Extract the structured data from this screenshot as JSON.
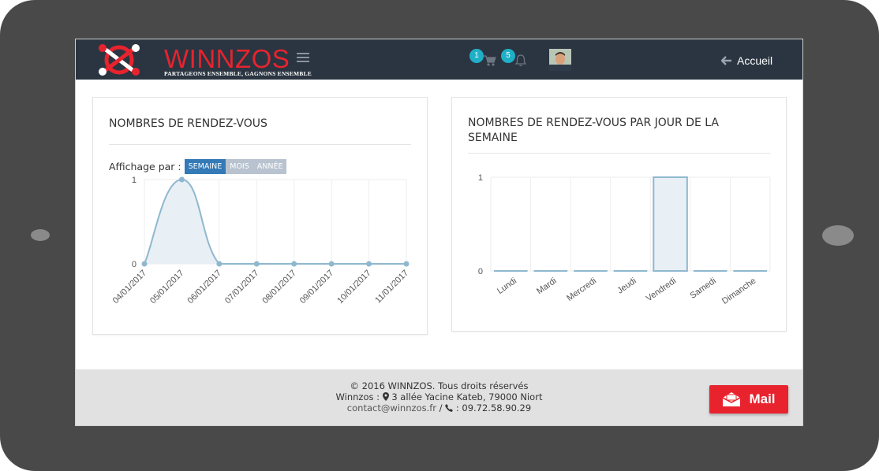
{
  "navbar": {
    "brand": "WINNZOS",
    "tagline": "PARTAGEONS ENSEMBLE, GAGNONS ENSEMBLE",
    "cart_count": "1",
    "notification_count": "5",
    "home_label": "Accueil"
  },
  "left_panel": {
    "title": "NOMBRES DE RENDEZ-VOUS",
    "display_label": "Affichage par :",
    "buttons": [
      "SEMAINE",
      "MOIS",
      "ANNÉE"
    ],
    "active_button": "SEMAINE"
  },
  "right_panel": {
    "title_line1": "NOMBRES DE RENDEZ-VOUS PAR JOUR DE LA",
    "title_line2": "SEMAINE"
  },
  "footer": {
    "copyright": "© 2016 WINNZOS. Tous droits réservés",
    "address_prefix": "Winnzos :",
    "address": "3 allée Yacine Kateb, 79000 Niort",
    "email": "contact@winnzos.fr",
    "separator": "/",
    "phone": ": 09.72.58.90.29",
    "mail_button": "Mail"
  },
  "colors": {
    "navbar_bg": "#2a3541",
    "brand_red": "#e8232e",
    "badge": "#1fb0c8",
    "series_line": "#8fb8cf",
    "series_fill": "#e8eff5",
    "active_button": "#337ab7"
  },
  "chart_data": [
    {
      "type": "area",
      "categories": [
        "04/01/2017",
        "05/01/2017",
        "06/01/2017",
        "07/01/2017",
        "08/01/2017",
        "09/01/2017",
        "10/01/2017",
        "11/01/2017"
      ],
      "values": [
        0,
        1,
        0,
        0,
        0,
        0,
        0,
        0
      ],
      "ylim": [
        0,
        1
      ],
      "yticks": [
        "0",
        "1"
      ],
      "grid": true
    },
    {
      "type": "bar",
      "categories": [
        "Lundi",
        "Mardi",
        "Mercredi",
        "Jeudi",
        "Vendredi",
        "Samedi",
        "Dimanche"
      ],
      "values": [
        0,
        0,
        0,
        0,
        1,
        0,
        0
      ],
      "ylim": [
        0,
        1
      ],
      "yticks": [
        "0",
        "1"
      ],
      "grid": true
    }
  ]
}
